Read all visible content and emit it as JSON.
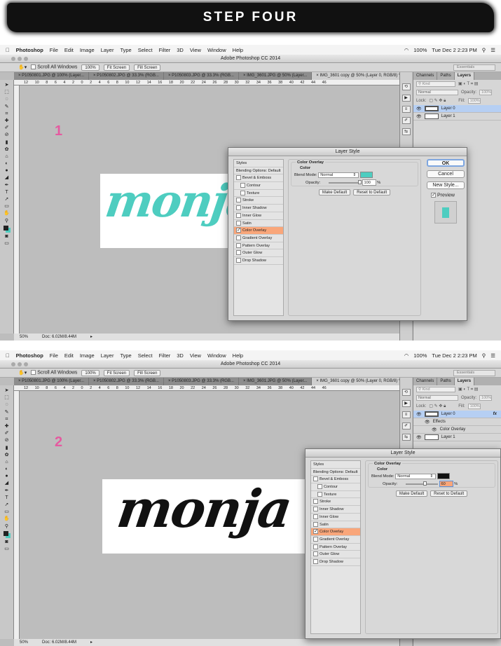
{
  "banner": "STEP FOUR",
  "menubar": {
    "app": "Photoshop",
    "items": [
      "File",
      "Edit",
      "Image",
      "Layer",
      "Type",
      "Select",
      "Filter",
      "3D",
      "View",
      "Window",
      "Help"
    ],
    "status": [
      "100%",
      "Tue Dec 2  2:23 PM"
    ]
  },
  "window_title": "Adobe Photoshop CC 2014",
  "options": {
    "scroll_all": "Scroll All Windows",
    "zoom100": "100%",
    "fit": "Fit Screen",
    "fill": "Fill Screen",
    "workspace": "Essentials"
  },
  "tabs": [
    "P1050801.JPG @ 100% (Layer...",
    "P1050802.JPG @ 33.3% (RGB...",
    "P1050803.JPG @ 33.3% (RGB...",
    "IMG_3601.JPG @ 50% (Layer...",
    "IMG_3601 copy @ 50% (Layer 0, RGB/8) *"
  ],
  "ruler_ticks": [
    "12",
    "10",
    "8",
    "6",
    "4",
    "2",
    "0",
    "2",
    "4",
    "6",
    "8",
    "10",
    "12",
    "14",
    "16",
    "18",
    "20",
    "22",
    "24",
    "26",
    "28",
    "30",
    "32",
    "34",
    "36",
    "38",
    "40",
    "42",
    "44",
    "46"
  ],
  "status": {
    "zoom": "50%",
    "doc": "Doc: 6.02M/8.44M"
  },
  "layers_panel": {
    "tabs": [
      "Channels",
      "Paths",
      "Layers"
    ],
    "kind": "Kind",
    "blend": "Normal",
    "opacity_label": "Opacity:",
    "opacity": "100%",
    "lock_label": "Lock:",
    "fill_label": "Fill:",
    "fill": "100%",
    "layer0": "Layer 0",
    "layer1": "Layer 1",
    "effects": "Effects",
    "color_overlay": "Color Overlay",
    "fx": "fx"
  },
  "dialog": {
    "title": "Layer Style",
    "styles": [
      "Styles",
      "Blending Options: Default",
      "Bevel & Emboss",
      "Contour",
      "Texture",
      "Stroke",
      "Inner Shadow",
      "Inner Glow",
      "Satin",
      "Color Overlay",
      "Gradient Overlay",
      "Pattern Overlay",
      "Outer Glow",
      "Drop Shadow"
    ],
    "group_title": "Color Overlay",
    "group_sub": "Color",
    "blend_label": "Blend Mode:",
    "blend_value": "Normal",
    "opacity_label": "Opacity:",
    "percent": "%",
    "make_default": "Make Default",
    "reset_default": "Reset to Default",
    "ok": "OK",
    "cancel": "Cancel",
    "new_style": "New Style...",
    "preview": "Preview"
  },
  "screens": [
    {
      "step": "1",
      "word": "monja",
      "overlay_color": "#4ecdc0",
      "opacity": "100",
      "opacity_fraction": 1.0
    },
    {
      "step": "2",
      "word": "monja",
      "overlay_color": "#111111",
      "opacity": "60",
      "opacity_fraction": 0.6
    }
  ]
}
